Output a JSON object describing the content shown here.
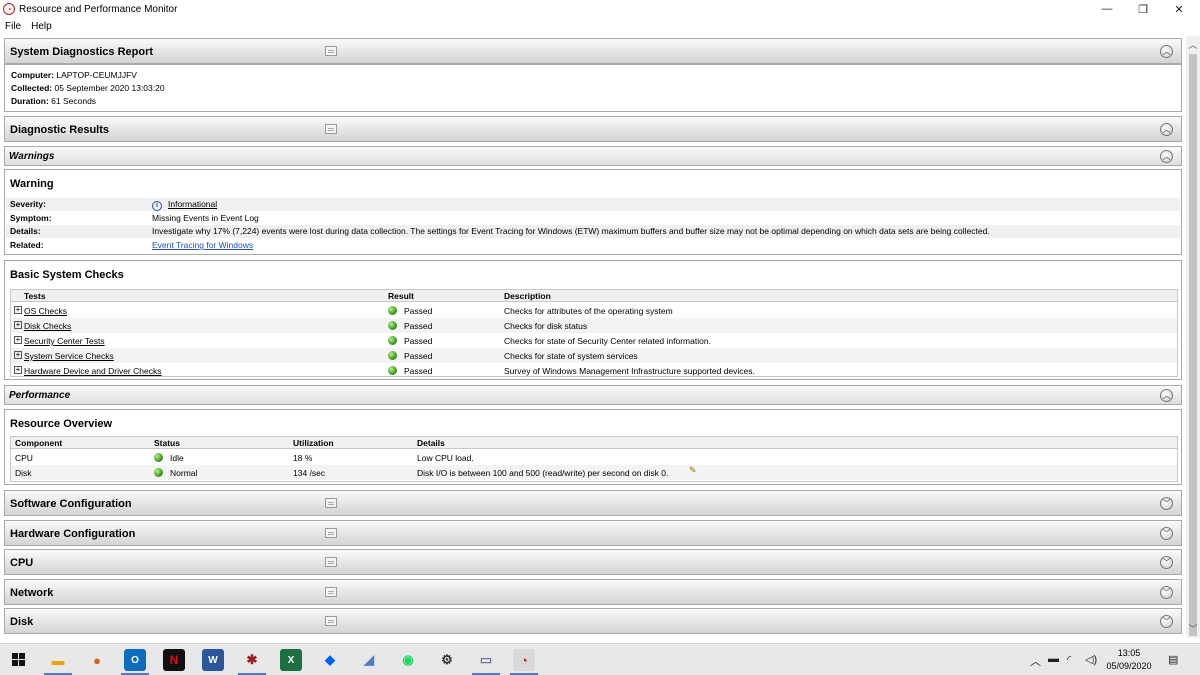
{
  "window": {
    "title": "Resource and Performance Monitor",
    "minimize": "—",
    "maximize": "❐",
    "close": "✕"
  },
  "menu": [
    "File",
    "Help"
  ],
  "report": {
    "title": "System Diagnostics Report",
    "computer_label": "Computer:",
    "computer": "LAPTOP-CEUMJJFV",
    "collected_label": "Collected:",
    "collected": "05 September 2020 13:03:20",
    "duration_label": "Duration:",
    "duration": "61 Seconds"
  },
  "diagnostic_results": {
    "title": "Diagnostic Results"
  },
  "warnings": {
    "title": "Warnings",
    "warning_title": "Warning",
    "rows": [
      {
        "key": "Severity:",
        "value": "Informational"
      },
      {
        "key": "Symptom:",
        "value": "Missing Events in Event Log"
      },
      {
        "key": "Details:",
        "value": "Investigate why 17% (7,224) events were lost during data collection. The settings for Event Tracing for Windows (ETW) maximum buffers and buffer size may not be optimal depending on which data sets are being collected."
      },
      {
        "key": "Related:",
        "value": "Event Tracing for Windows"
      }
    ]
  },
  "basic_checks": {
    "title": "Basic System Checks",
    "columns": [
      "Tests",
      "Result",
      "Description"
    ],
    "rows": [
      {
        "test": "OS Checks",
        "result": "Passed",
        "description": "Checks for attributes of the operating system"
      },
      {
        "test": "Disk Checks",
        "result": "Passed",
        "description": "Checks for disk status"
      },
      {
        "test": "Security Center Tests",
        "result": "Passed",
        "description": "Checks for state of Security Center related information."
      },
      {
        "test": "System Service Checks",
        "result": "Passed",
        "description": "Checks for state of system services"
      },
      {
        "test": "Hardware Device and Driver Checks",
        "result": "Passed",
        "description": "Survey of Windows Management Infrastructure supported devices."
      }
    ]
  },
  "performance": {
    "title": "Performance",
    "resource_title": "Resource Overview",
    "columns": [
      "Component",
      "Status",
      "Utilization",
      "Details"
    ],
    "rows": [
      {
        "component": "CPU",
        "status": "Idle",
        "utilization": "18 %",
        "details": "Low CPU load."
      },
      {
        "component": "Disk",
        "status": "Normal",
        "utilization": "134 /sec",
        "details": "Disk I/O is between 100 and 500 (read/write) per second on disk 0."
      }
    ]
  },
  "collapsed_sections": [
    "Software Configuration",
    "Hardware Configuration",
    "CPU",
    "Network",
    "Disk"
  ],
  "taskbar": {
    "time": "13:05",
    "date": "05/09/2020"
  },
  "colors": {
    "passed": "#3d9a1d",
    "link": "#1a53b3",
    "taskbar_bg": "#e8e8e8"
  }
}
